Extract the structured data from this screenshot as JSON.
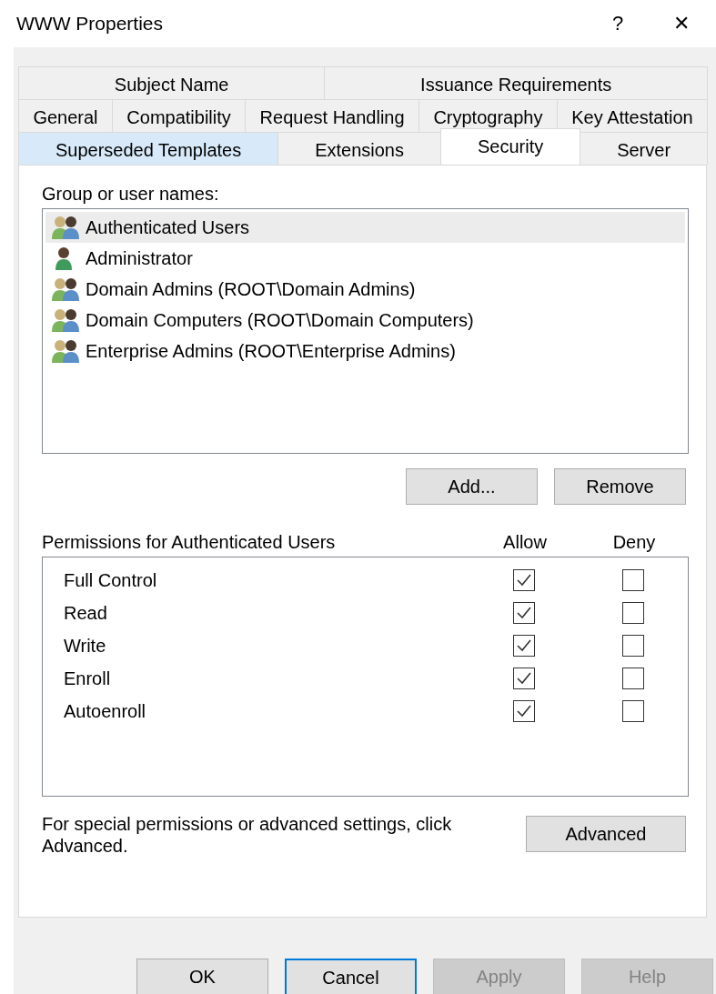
{
  "window": {
    "title": "WWW Properties",
    "help": "?",
    "close": "✕"
  },
  "tab_rows": [
    [
      {
        "label": "Subject Name",
        "selected": false,
        "hovered": false
      },
      {
        "label": "Issuance Requirements",
        "selected": false,
        "hovered": false
      }
    ],
    [
      {
        "label": "General",
        "selected": false,
        "hovered": false
      },
      {
        "label": "Compatibility",
        "selected": false,
        "hovered": false
      },
      {
        "label": "Request Handling",
        "selected": false,
        "hovered": false
      },
      {
        "label": "Cryptography",
        "selected": false,
        "hovered": false
      },
      {
        "label": "Key Attestation",
        "selected": false,
        "hovered": false
      }
    ],
    [
      {
        "label": "Superseded Templates",
        "selected": false,
        "hovered": true
      },
      {
        "label": "Extensions",
        "selected": false,
        "hovered": false
      },
      {
        "label": "Security",
        "selected": true,
        "hovered": false
      },
      {
        "label": "Server",
        "selected": false,
        "hovered": false
      }
    ]
  ],
  "names_label": "Group or user names:",
  "principals": [
    {
      "name": "Authenticated Users",
      "kind": "group",
      "selected": true
    },
    {
      "name": "Administrator",
      "kind": "user",
      "selected": false
    },
    {
      "name": "Domain Admins (ROOT\\Domain Admins)",
      "kind": "group",
      "selected": false
    },
    {
      "name": "Domain Computers (ROOT\\Domain Computers)",
      "kind": "group",
      "selected": false
    },
    {
      "name": "Enterprise Admins (ROOT\\Enterprise Admins)",
      "kind": "group",
      "selected": false
    }
  ],
  "list_buttons": [
    {
      "label": "Add...",
      "disabled": false
    },
    {
      "label": "Remove",
      "disabled": false
    }
  ],
  "permissions": {
    "title": "Permissions for Authenticated Users",
    "allow_header": "Allow",
    "deny_header": "Deny",
    "rows": [
      {
        "name": "Full Control",
        "allow": true,
        "deny": false
      },
      {
        "name": "Read",
        "allow": true,
        "deny": false
      },
      {
        "name": "Write",
        "allow": true,
        "deny": false
      },
      {
        "name": "Enroll",
        "allow": true,
        "deny": false
      },
      {
        "name": "Autoenroll",
        "allow": true,
        "deny": false
      }
    ]
  },
  "advanced_note": "For special permissions or advanced settings, click Advanced.",
  "advanced_button": "Advanced",
  "dialog_buttons": [
    {
      "label": "OK",
      "disabled": false,
      "focused": false
    },
    {
      "label": "Cancel",
      "disabled": false,
      "focused": true
    },
    {
      "label": "Apply",
      "disabled": true,
      "focused": false
    },
    {
      "label": "Help",
      "disabled": true,
      "focused": false
    }
  ]
}
